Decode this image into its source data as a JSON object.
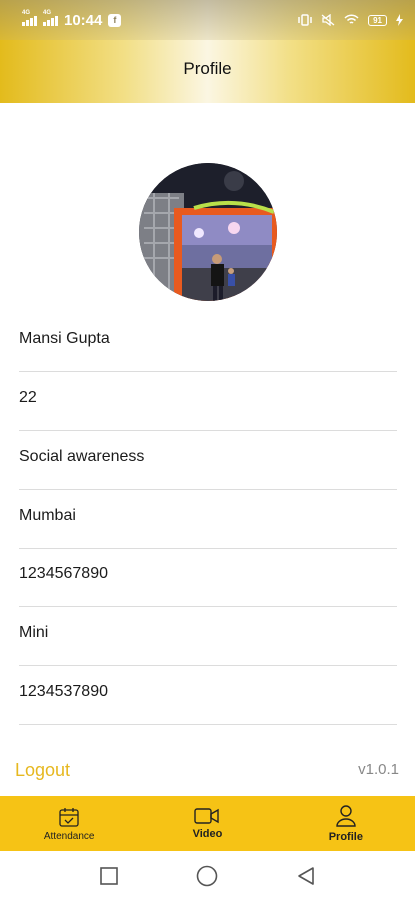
{
  "status_bar": {
    "time": "10:44",
    "network_1": "4G",
    "network_2": "4G",
    "battery": "91",
    "icons": [
      "vibrate-icon",
      "mute-icon",
      "wifi-icon",
      "battery-icon",
      "charging-icon"
    ]
  },
  "header": {
    "title": "Profile"
  },
  "profile": {
    "fields": [
      {
        "value": "Mansi Gupta"
      },
      {
        "value": "22"
      },
      {
        "value": "Social awareness"
      },
      {
        "value": "Mumbai"
      },
      {
        "value": "1234567890"
      },
      {
        "value": "Mini"
      },
      {
        "value": "1234537890"
      }
    ]
  },
  "footer": {
    "logout_label": "Logout",
    "version": "v1.0.1"
  },
  "bottom_nav": {
    "items": [
      {
        "label": "Attendance",
        "icon": "calendar-icon"
      },
      {
        "label": "Video",
        "icon": "video-icon"
      },
      {
        "label": "Profile",
        "icon": "person-icon"
      }
    ]
  },
  "system_nav": {
    "icons": [
      "square-icon",
      "circle-icon",
      "triangle-back-icon"
    ]
  },
  "colors": {
    "accent": "#f6c315",
    "logout": "#e6b820",
    "divider": "#dcdcdc"
  }
}
